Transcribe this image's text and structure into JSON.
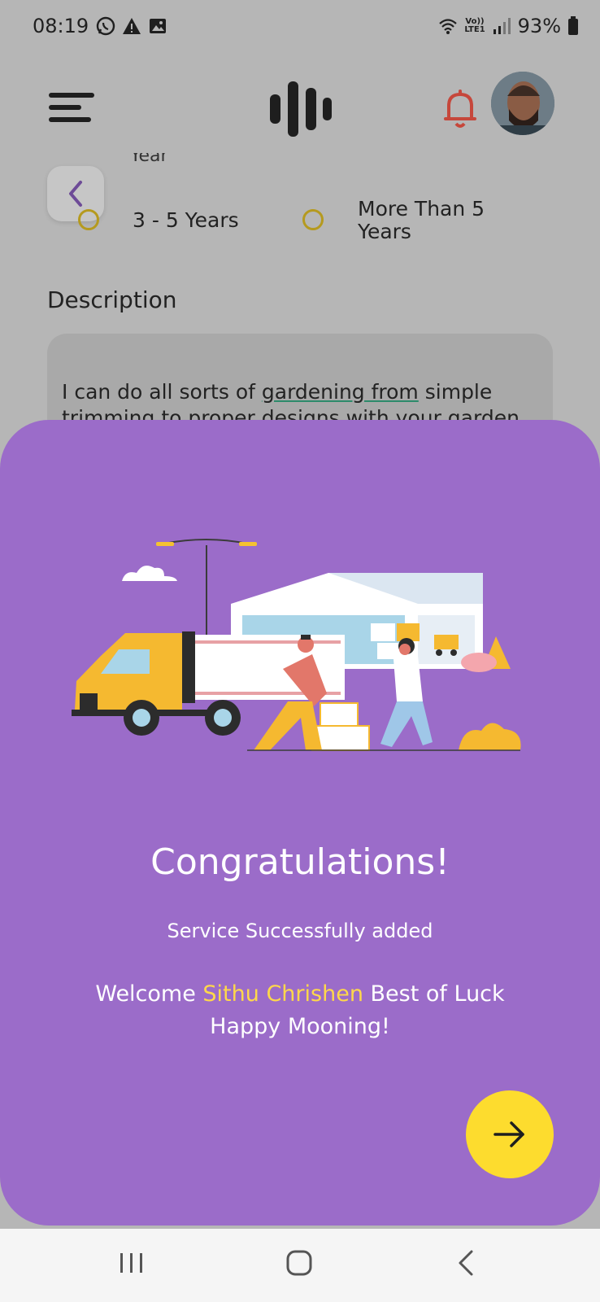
{
  "status_bar": {
    "time": "08:19",
    "signal_label_top": "Vo))",
    "signal_label_bottom": "LTE1",
    "battery": "93%"
  },
  "app_bar": {
    "menu_icon": "menu-icon",
    "logo_icon": "logo-icon",
    "bell_icon": "bell-icon",
    "avatar": "avatar"
  },
  "form": {
    "cut_off_label": "Year",
    "experience_options": [
      {
        "label": "3 - 5 Years"
      },
      {
        "label": "More Than 5 Years",
        "line1": "More Than 5",
        "line2": "Years"
      }
    ],
    "description_label": "Description",
    "description_text_part1": "I can do all sorts of ",
    "description_text_underlined": "gardening from",
    "description_text_part2": " simple trimming to proper designs with your garden"
  },
  "modal": {
    "title": "Congratulations!",
    "subtitle": "Service Successfully added",
    "welcome_prefix": "Welcome ",
    "user_name": "Sithu Chrishen",
    "welcome_suffix": " Best of Luck",
    "welcome_line2": "Happy Mooning!",
    "next_icon": "arrow-right-icon",
    "colors": {
      "background": "#9b6cc9",
      "name_highlight": "#ffd84a",
      "next_button": "#fddc2e"
    }
  },
  "nav_bar": {
    "recent": "recent-apps-icon",
    "home": "home-icon",
    "back": "back-icon"
  }
}
